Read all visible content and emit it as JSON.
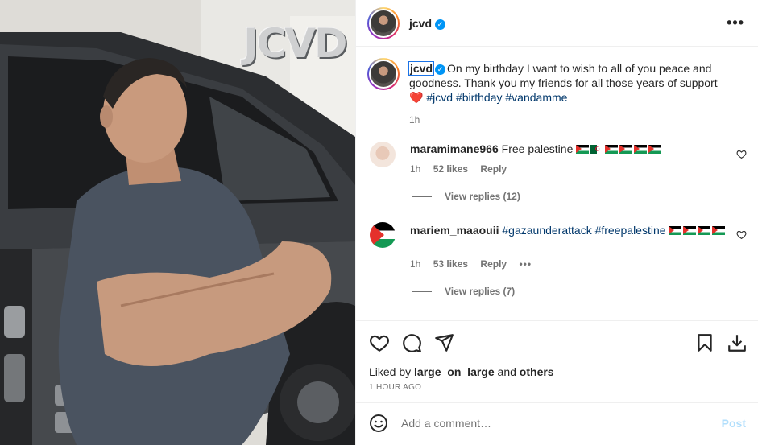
{
  "photo": {
    "watermark": "JCVD",
    "alt": "Man in grey t-shirt leaning against a black car with arms crossed"
  },
  "header": {
    "username": "jcvd",
    "verified": true,
    "more_icon": "more-horizontal-icon"
  },
  "caption": {
    "username": "jcvd",
    "text": "On my birthday I want to wish to all of you peace and goodness. Thank you my friends for all those years of support",
    "emoji": "❤️",
    "hashtags": [
      "#jcvd",
      "#birthday",
      "#vandamme"
    ],
    "time": "1h"
  },
  "comments": [
    {
      "username": "maramimane966",
      "text": "Free palestine",
      "time": "1h",
      "likes": "52 likes",
      "reply": "Reply",
      "view_replies": "View replies (12)"
    },
    {
      "username": "mariem_maaouii",
      "hashtags": [
        "#gazaunderattack",
        "#freepalestine"
      ],
      "time": "1h",
      "likes": "53 likes",
      "reply": "Reply",
      "options": "•••",
      "view_replies": "View replies (7)"
    }
  ],
  "actions": {
    "liked_by_prefix": "Liked by",
    "liked_by_user": "large_on_large",
    "liked_by_and": "and",
    "liked_by_others": "others",
    "time_ago": "1 HOUR AGO"
  },
  "add_comment": {
    "placeholder": "Add a comment…",
    "post_label": "Post"
  },
  "colors": {
    "link": "#00376b",
    "verified": "#0095f6",
    "muted": "#737373",
    "post_disabled": "#b2dffc"
  }
}
